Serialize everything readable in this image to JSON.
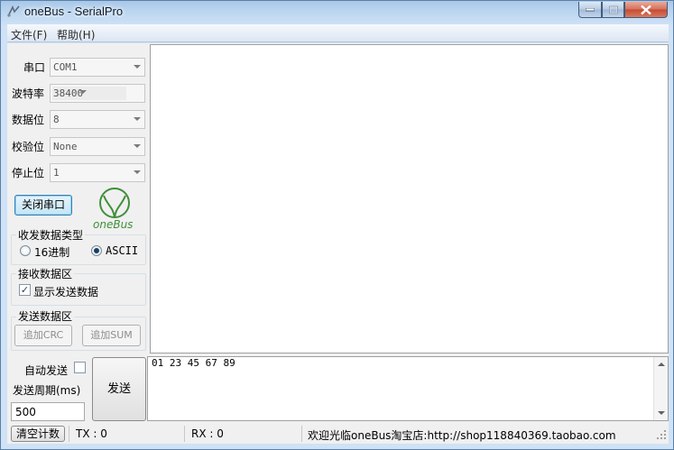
{
  "window": {
    "title": "oneBus - SerialPro"
  },
  "menu": [
    {
      "label": "文件(F)"
    },
    {
      "label": "帮助(H)"
    }
  ],
  "settings": {
    "port": {
      "label": "串口",
      "value": "COM1"
    },
    "baud": {
      "label": "波特率",
      "value": "38400"
    },
    "data": {
      "label": "数据位",
      "value": "8"
    },
    "parity": {
      "label": "校验位",
      "value": "None"
    },
    "stop": {
      "label": "停止位",
      "value": "1"
    }
  },
  "close_port_label": "关闭串口",
  "logo_text": "oneBus",
  "data_type": {
    "title": "收发数据类型",
    "options": [
      {
        "label": "16进制",
        "selected": false
      },
      {
        "label": "ASCII",
        "selected": true
      }
    ]
  },
  "receive_area": {
    "title": "接收数据区",
    "show_sent": {
      "label": "显示发送数据",
      "checked": true
    }
  },
  "send_area": {
    "title": "发送数据区",
    "add_crc_label": "追加CRC",
    "add_sum_label": "追加SUM"
  },
  "send_panel": {
    "auto_send_label": "自动发送",
    "auto_send_checked": false,
    "period_label": "发送周期(ms)",
    "period_value": "500",
    "send_label": "发送",
    "tx_text": "01 23 45 67 89"
  },
  "status": {
    "clear_label": "清空计数",
    "tx": "TX : 0",
    "rx": "RX : 0",
    "shop": "欢迎光临oneBus淘宝店:http://shop118840369.taobao.com"
  },
  "colors": {
    "logo": "#3f8f3a",
    "accent": "#3c7fb1"
  }
}
